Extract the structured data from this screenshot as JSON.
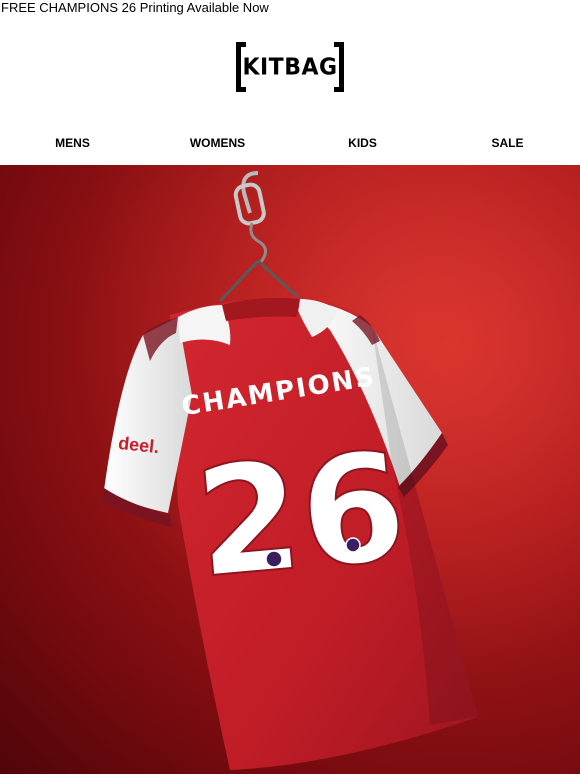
{
  "preheader": {
    "text": "FREE CHAMPIONS 26 Printing Available Now"
  },
  "brand": {
    "logo_text": "KITBAG"
  },
  "nav": {
    "items": [
      {
        "label": "MENS"
      },
      {
        "label": "WOMENS"
      },
      {
        "label": "KIDS"
      },
      {
        "label": "SALE"
      }
    ]
  },
  "hero": {
    "shirt_name": "CHAMPIONS",
    "shirt_number": "26",
    "sponsor": "deel."
  },
  "colors": {
    "shirt_red": "#c8202a",
    "sleeve_white": "#f2f2f2",
    "trim_maroon": "#7a1420",
    "background_red": "#a3151a"
  }
}
